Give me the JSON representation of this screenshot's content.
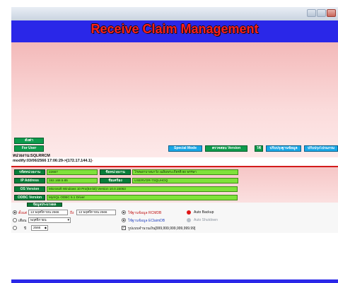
{
  "window": {
    "title": "Receive Claim Management",
    "controls": [
      "minimize",
      "maximize",
      "close"
    ]
  },
  "buttons": {
    "btn1": "ตั้งค่า",
    "btn2": "For User",
    "special_mode": "Special Mode",
    "check_version": "ตรวจสอบ Version",
    "btn_t": "ใช้",
    "adjust1": "ปรับปรุงฐานข้อมูล",
    "adjust2": "ปรับปรุงโปรแกรม"
  },
  "info": {
    "line1": "หน่วยงาน:SQLRRCM",
    "line2_prefix": "modify:03/06/2566 17:06:29->[172.17.144.1]",
    "line2_suffix": "-"
  },
  "fields": {
    "code_label": "รหัสหน่วยงาน",
    "code_value": "22667",
    "name_label": "ชื่อหน่วยงาน",
    "name_value": "โรงพยาบาลนาวัง เฉลิมพระเกียรติ 80 พรรษา",
    "ip_label": "IP Address",
    "ip_value": "192.168.5.85",
    "machine_label": "ชื่อเครื่อง",
    "machine_value": "USERVOR-7SQUHOQ",
    "os_label": "OS Version",
    "os_value": "Microsoft Windows 10 Pro(64-bit) Version 10.0.15063",
    "odbc_label": "ODBC Version",
    "odbc_value": "MySQL ODBC 5.1 Driver"
  },
  "options": {
    "header": "ข้อมูลประมวลผล",
    "date_label": "ตั้งแต่",
    "date_from": "13 พฤศจิกายน 2566",
    "date_to_label": "ถึง",
    "date_to": "13 พฤศจิกายน 2566",
    "month_label": "เดือน",
    "month_value": "พฤศจิกายน",
    "year_label": "ปี",
    "year_value": "2566",
    "radio_rcmdb": "ใช้ฐานข้อมูล RCMDB",
    "radio_eclaim": "ใช้ฐานข้อมูล EClaimDB",
    "auto_backup": "Auto Backup",
    "auto_shutdown": "Auto Shutdown",
    "check_amount": "รูปแบบจำนวนเงิน[999,999,999,999,999.99]",
    "auto_backup_color": "#e01515",
    "auto_shutdown_color": "#b9c0c9"
  }
}
